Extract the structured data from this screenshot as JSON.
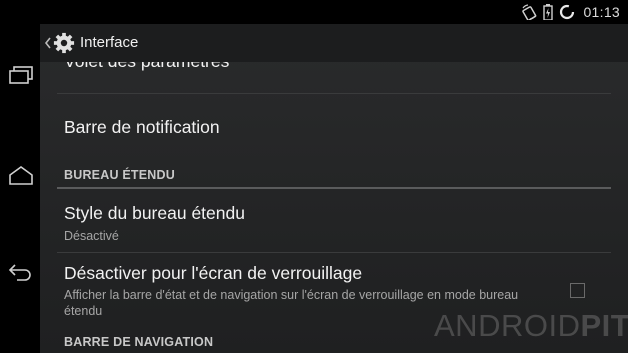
{
  "status_bar": {
    "time": "01:13",
    "icons": [
      "screen-rotation-icon",
      "battery-icon",
      "loading-ring-icon"
    ]
  },
  "nav_bar": {
    "buttons": [
      "recent-apps-icon",
      "home-icon",
      "back-icon"
    ]
  },
  "action_bar": {
    "title": "Interface",
    "icon": "gear-icon"
  },
  "preferences": {
    "partial_item": "Volet des paramètres",
    "notification_bar": "Barre de notification",
    "section_extended_desktop": "BUREAU ÉTENDU",
    "desktop_style": {
      "title": "Style du bureau étendu",
      "summary": "Désactivé"
    },
    "lockscreen": {
      "title": "Désactiver pour l'écran de verrouillage",
      "summary": "Afficher la barre d'état et de navigation sur l'écran de verrouillage en mode bureau étendu",
      "checked": false
    },
    "section_nav_bar": "BARRE DE NAVIGATION"
  },
  "watermark": {
    "part1": "ANDROID",
    "part2": "PIT"
  }
}
